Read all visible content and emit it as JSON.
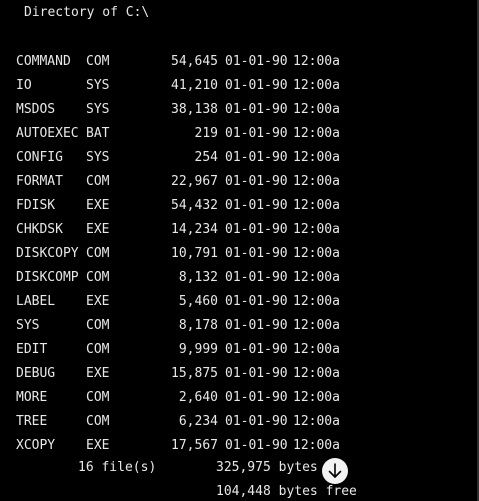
{
  "console": {
    "header": "Directory of C:\\",
    "files": [
      {
        "name": "COMMAND",
        "ext": "COM",
        "size": "54,645",
        "date": "01-01-90",
        "time": "12:00a"
      },
      {
        "name": "IO",
        "ext": "SYS",
        "size": "41,210",
        "date": "01-01-90",
        "time": "12:00a"
      },
      {
        "name": "MSDOS",
        "ext": "SYS",
        "size": "38,138",
        "date": "01-01-90",
        "time": "12:00a"
      },
      {
        "name": "AUTOEXEC",
        "ext": "BAT",
        "size": "219",
        "date": "01-01-90",
        "time": "12:00a"
      },
      {
        "name": "CONFIG",
        "ext": "SYS",
        "size": "254",
        "date": "01-01-90",
        "time": "12:00a"
      },
      {
        "name": "FORMAT",
        "ext": "COM",
        "size": "22,967",
        "date": "01-01-90",
        "time": "12:00a"
      },
      {
        "name": "FDISK",
        "ext": "EXE",
        "size": "54,432",
        "date": "01-01-90",
        "time": "12:00a"
      },
      {
        "name": "CHKDSK",
        "ext": "EXE",
        "size": "14,234",
        "date": "01-01-90",
        "time": "12:00a"
      },
      {
        "name": "DISKCOPY",
        "ext": "COM",
        "size": "10,791",
        "date": "01-01-90",
        "time": "12:00a"
      },
      {
        "name": "DISKCOMP",
        "ext": "COM",
        "size": "8,132",
        "date": "01-01-90",
        "time": "12:00a"
      },
      {
        "name": "LABEL",
        "ext": "EXE",
        "size": "5,460",
        "date": "01-01-90",
        "time": "12:00a"
      },
      {
        "name": "SYS",
        "ext": "COM",
        "size": "8,178",
        "date": "01-01-90",
        "time": "12:00a"
      },
      {
        "name": "EDIT",
        "ext": "COM",
        "size": "9,999",
        "date": "01-01-90",
        "time": "12:00a"
      },
      {
        "name": "DEBUG",
        "ext": "EXE",
        "size": "15,875",
        "date": "01-01-90",
        "time": "12:00a"
      },
      {
        "name": "MORE",
        "ext": "COM",
        "size": "2,640",
        "date": "01-01-90",
        "time": "12:00a"
      },
      {
        "name": "TREE",
        "ext": "COM",
        "size": "6,234",
        "date": "01-01-90",
        "time": "12:00a"
      },
      {
        "name": "XCOPY",
        "ext": "EXE",
        "size": "17,567",
        "date": "01-01-90",
        "time": "12:00a"
      }
    ],
    "summary_files": "16 file(s)",
    "summary_bytes": "325,975 bytes",
    "summary_free": "104,448 bytes free"
  },
  "scroll_button": {
    "icon": "arrow-down-icon"
  },
  "colors": {
    "background": "#000000",
    "text": "#e8e8e8",
    "button": "#f2f2f2"
  }
}
